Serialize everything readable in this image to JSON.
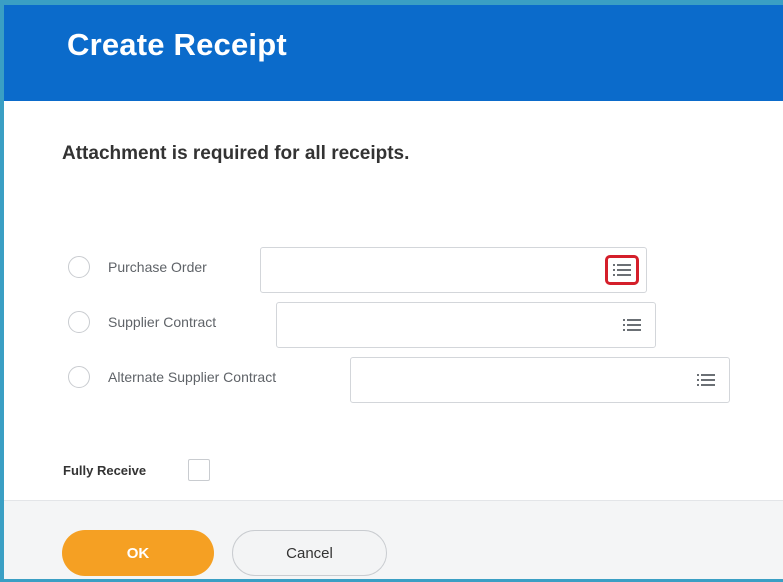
{
  "dialog": {
    "title": "Create Receipt",
    "message": "Attachment is required for all receipts."
  },
  "options": [
    {
      "label": "Purchase Order",
      "value": "",
      "selected": false
    },
    {
      "label": "Supplier Contract",
      "value": "",
      "selected": false
    },
    {
      "label": "Alternate Supplier Contract",
      "value": "",
      "selected": false
    }
  ],
  "fully_receive": {
    "label": "Fully Receive",
    "checked": false
  },
  "buttons": {
    "ok": "OK",
    "cancel": "Cancel"
  },
  "icons": {
    "prompt": "list-prompt-icon"
  },
  "colors": {
    "header": "#0b6bcb",
    "ok_button": "#f5a023",
    "highlight": "#d41f2a"
  }
}
